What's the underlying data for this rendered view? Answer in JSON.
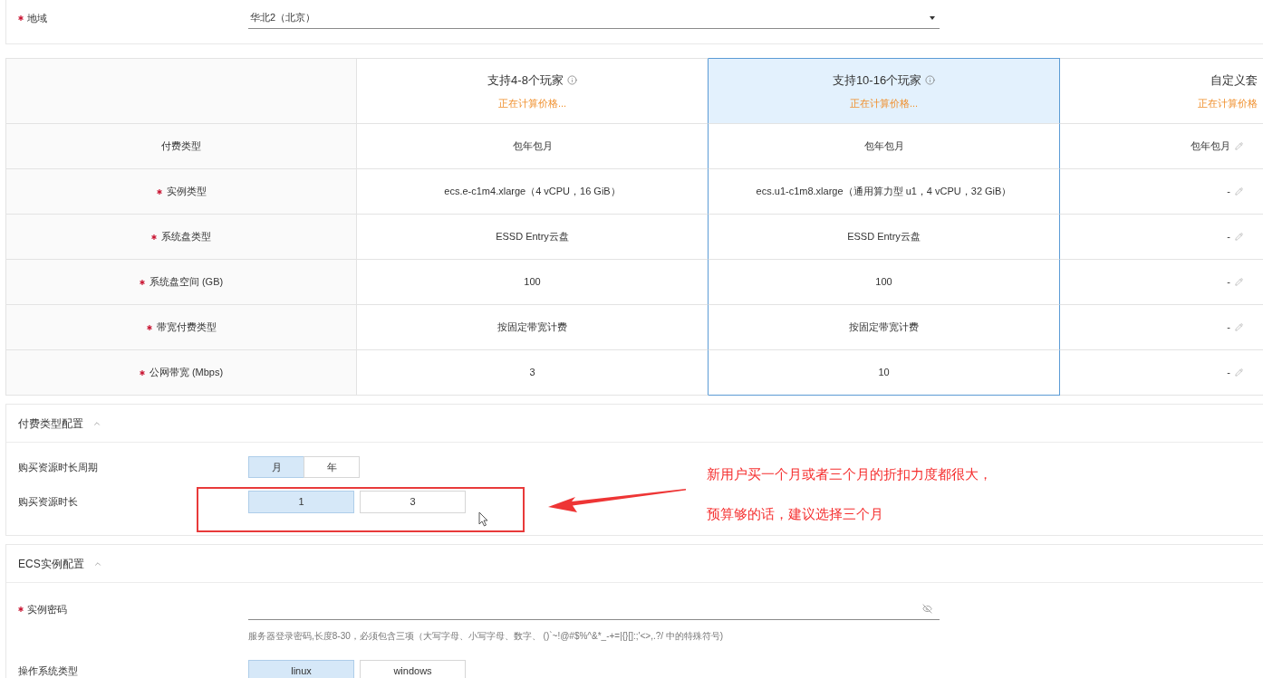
{
  "region": {
    "label": "地域",
    "required": true,
    "value": "华北2（北京）"
  },
  "plans": {
    "columns": [
      {
        "title": "支持4-8个玩家",
        "status": "正在计算价格...",
        "info": true,
        "editable": false,
        "selected": false
      },
      {
        "title": "支持10-16个玩家",
        "status": "正在计算价格...",
        "info": true,
        "editable": false,
        "selected": true
      },
      {
        "title": "自定义套",
        "status": "正在计算价格",
        "info": false,
        "editable": true,
        "selected": false
      }
    ],
    "rows": [
      {
        "label": "付费类型",
        "required": false,
        "cells": [
          "包年包月",
          "包年包月",
          "包年包月"
        ]
      },
      {
        "label": "实例类型",
        "required": true,
        "cells": [
          "ecs.e-c1m4.xlarge（4 vCPU，16 GiB）",
          "ecs.u1-c1m8.xlarge（通用算力型 u1，4 vCPU，32 GiB）",
          "-"
        ]
      },
      {
        "label": "系统盘类型",
        "required": true,
        "cells": [
          "ESSD Entry云盘",
          "ESSD Entry云盘",
          "-"
        ]
      },
      {
        "label": "系统盘空间 (GB)",
        "required": true,
        "cells": [
          "100",
          "100",
          "-"
        ]
      },
      {
        "label": "带宽付费类型",
        "required": true,
        "cells": [
          "按固定带宽计费",
          "按固定带宽计费",
          "-"
        ]
      },
      {
        "label": "公网带宽 (Mbps)",
        "required": true,
        "cells": [
          "3",
          "10",
          "-"
        ]
      }
    ]
  },
  "payment_config": {
    "title": "付费类型配置",
    "expanded": true,
    "fields": [
      {
        "label": "购买资源时长周期",
        "kind": "segmented",
        "options": [
          {
            "label": "月",
            "selected": true
          },
          {
            "label": "年",
            "selected": false
          }
        ]
      },
      {
        "label": "购买资源时长",
        "kind": "tiles",
        "options": [
          {
            "label": "1",
            "selected": true
          },
          {
            "label": "3",
            "selected": false
          }
        ]
      }
    ]
  },
  "annotation": {
    "lines": [
      "新用户买一个月或者三个月的折扣力度都很大，",
      "预算够的话，建议选择三个月"
    ]
  },
  "ecs_config": {
    "title": "ECS实例配置",
    "expanded": true,
    "password": {
      "label": "实例密码",
      "required": true,
      "hint": "服务器登录密码,长度8-30，必须包含三项（大写字母、小写字母、数字、 ()`~!@#$%^&*_-+=|{}[]:;'<>,.?/ 中的特殊符号)"
    },
    "os_type": {
      "label": "操作系统类型",
      "kind": "tiles",
      "options": [
        {
          "label": "linux",
          "selected": true
        },
        {
          "label": "windows",
          "selected": false
        }
      ]
    }
  }
}
